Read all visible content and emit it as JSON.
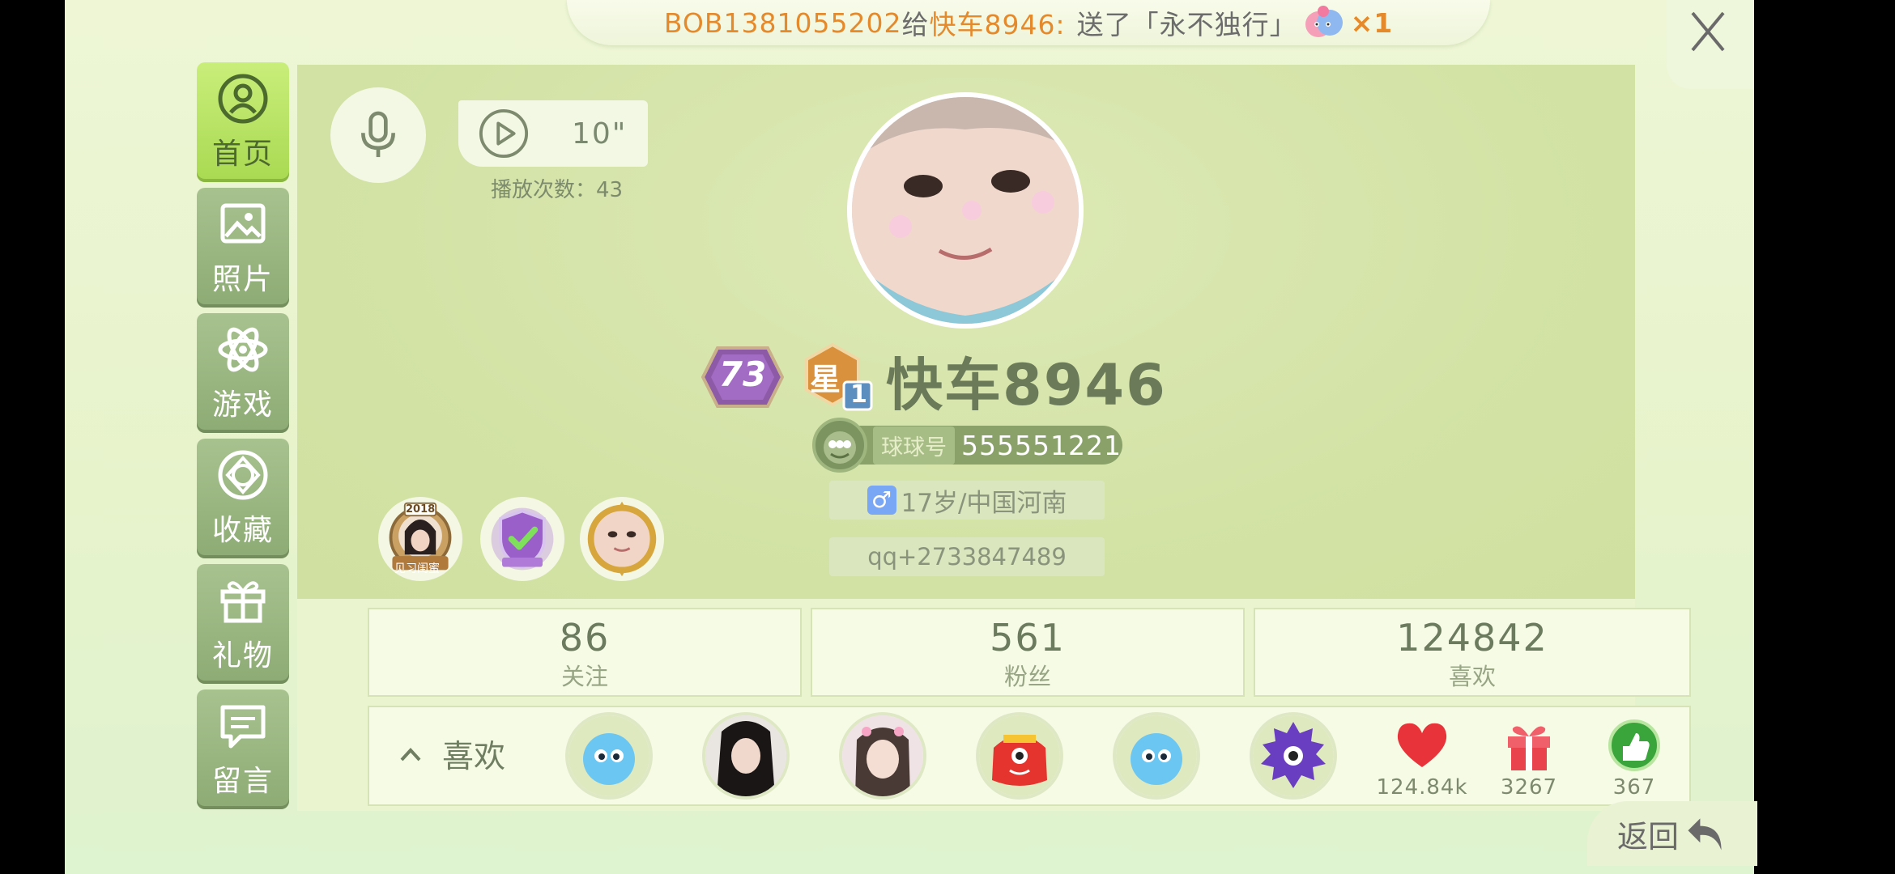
{
  "banner": {
    "sender": "BOB1381055202",
    "verb": "给",
    "receiver": "快车8946:",
    "message": "送了「永不独行」",
    "count": "×1"
  },
  "sidebar": {
    "items": [
      {
        "label": "首页",
        "icon": "home-person-icon",
        "active": true
      },
      {
        "label": "照片",
        "icon": "photo-icon",
        "active": false
      },
      {
        "label": "游戏",
        "icon": "atom-icon",
        "active": false
      },
      {
        "label": "收藏",
        "icon": "diamond-icon",
        "active": false
      },
      {
        "label": "礼物",
        "icon": "gift-icon",
        "active": false
      },
      {
        "label": "留言",
        "icon": "message-icon",
        "active": false
      }
    ]
  },
  "voice": {
    "duration": "10\"",
    "play_count": "播放次数：43"
  },
  "profile": {
    "level": "73",
    "star_char": "星",
    "star_level": "1",
    "username": "快车8946",
    "id_label": "球球号",
    "id_number": "555551221",
    "gender_symbol": "♂",
    "age_region": "17岁/中国河南",
    "qq": "qq+2733847489"
  },
  "medals": [
    {
      "year": "2018",
      "caption": "见习闺蜜"
    }
  ],
  "stats": [
    {
      "value": "86",
      "label": "关注"
    },
    {
      "value": "561",
      "label": "粉丝"
    },
    {
      "value": "124842",
      "label": "喜欢"
    }
  ],
  "likes_section": {
    "label": "喜欢",
    "hearts": "124.84k",
    "gifts": "3267",
    "thumbs": "367"
  },
  "back": {
    "label": "返回"
  },
  "colors": {
    "accent_green": "#a9d952",
    "sidebar_green": "#8dab74",
    "orange_text": "#e58a2c",
    "heart_red": "#e9333b"
  }
}
